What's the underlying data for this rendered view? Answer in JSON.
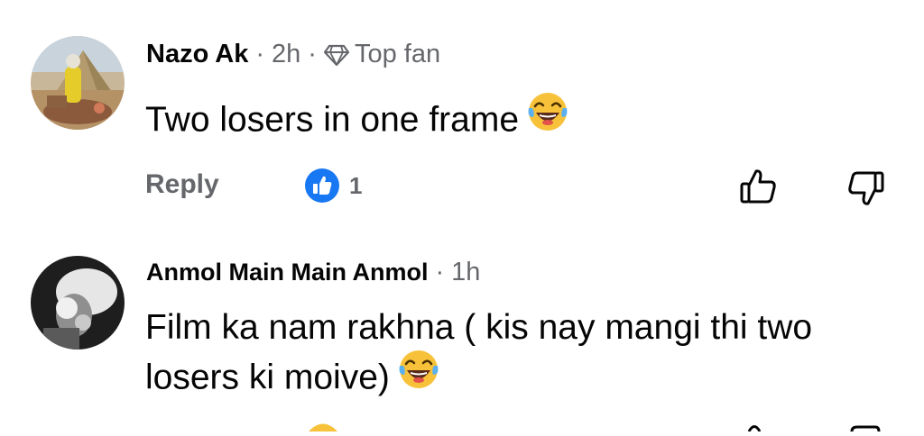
{
  "comments": [
    {
      "author": "Nazo Ak",
      "separator": "·",
      "time": "2h",
      "badge": "Top fan",
      "badge_icon": "diamond-icon",
      "text": "Two losers in one frame",
      "emoji": "face-with-tears-of-joy",
      "actions": {
        "reply": "Reply",
        "reaction_icon": "like-icon",
        "reaction_count": "1",
        "upvote_icon": "thumbs-up-outline-icon",
        "downvote_icon": "thumbs-down-outline-icon"
      }
    },
    {
      "author": "Anmol Main Main Anmol",
      "separator": "·",
      "time": "1h",
      "text": "Film ka nam rakhna ( kis nay mangi thi two losers ki moive)",
      "emoji": "face-with-tears-of-joy"
    }
  ],
  "colors": {
    "text_primary": "#050505",
    "text_secondary": "#65676b",
    "like_blue": "#1877f2",
    "emoji_yellow": "#f7c23a"
  }
}
